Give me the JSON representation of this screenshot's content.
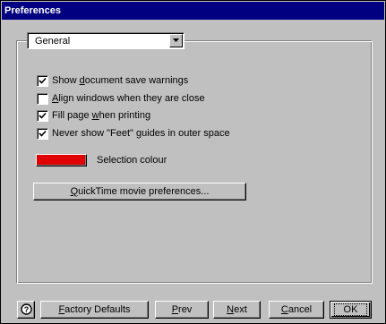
{
  "window": {
    "title": "Preferences"
  },
  "category": {
    "selected": "General"
  },
  "options": [
    {
      "checked": true,
      "pre": "Show ",
      "key": "d",
      "post": "ocument save warnings"
    },
    {
      "checked": false,
      "pre": "",
      "key": "A",
      "post": "lign windows when they are close"
    },
    {
      "checked": true,
      "pre": "Fill page ",
      "key": "w",
      "post": "hen printing"
    },
    {
      "checked": true,
      "pre": "Never show \"Feet\" guides in outer space",
      "key": "",
      "post": ""
    }
  ],
  "selection_colour": {
    "label": "Selection colour",
    "color": "#e00000"
  },
  "quicktime_button": {
    "key": "Q",
    "rest": "uickTime movie preferences..."
  },
  "buttons": {
    "help_icon": "help-icon",
    "factory": {
      "key": "F",
      "rest": "actory Defaults"
    },
    "prev": {
      "key": "P",
      "rest": "rev"
    },
    "next": {
      "key": "N",
      "rest": "ext"
    },
    "cancel": {
      "key": "C",
      "rest": "ancel"
    },
    "ok": "OK"
  }
}
